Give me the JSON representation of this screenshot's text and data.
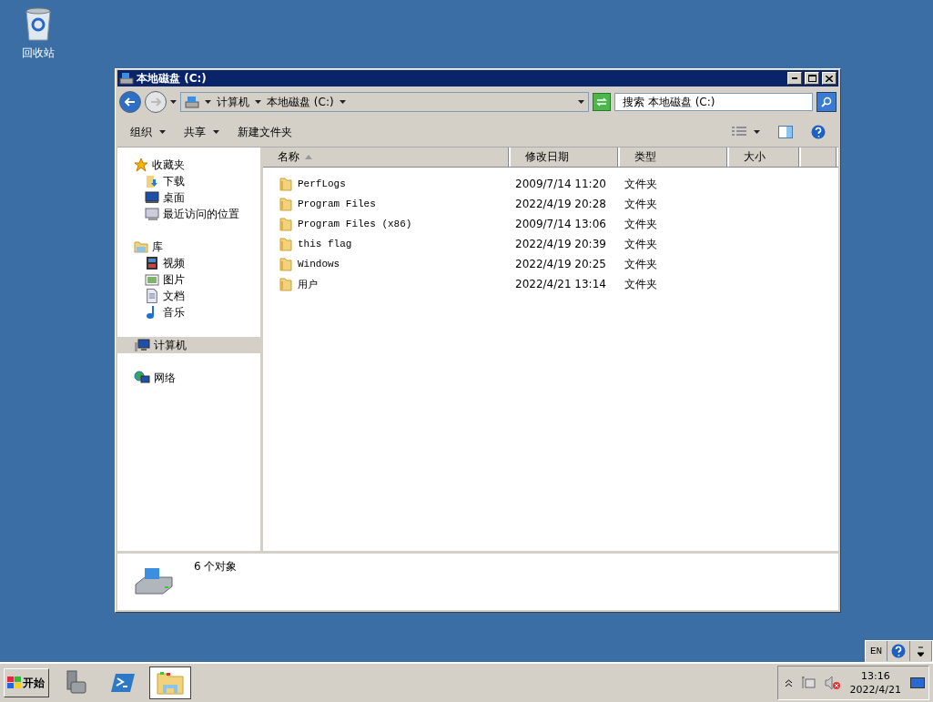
{
  "desktop_icons": [
    {
      "label": "回收站"
    }
  ],
  "window": {
    "title": "本地磁盘 (C:)",
    "address": {
      "segments": [
        "计算机",
        "本地磁盘 (C:)"
      ]
    },
    "search": {
      "placeholder": "搜索 本地磁盘 (C:)"
    },
    "toolbar": [
      {
        "label": "组织",
        "dropdown": true
      },
      {
        "label": "共享",
        "dropdown": true
      },
      {
        "label": "新建文件夹",
        "dropdown": false
      }
    ],
    "nav_groups": [
      {
        "label": "收藏夹",
        "kind": "star",
        "selected": false,
        "children": [
          {
            "label": "下载",
            "kind": "download",
            "selected": false
          },
          {
            "label": "桌面",
            "kind": "desktop",
            "selected": false
          },
          {
            "label": "最近访问的位置",
            "kind": "recent",
            "selected": false
          }
        ]
      },
      {
        "label": "库",
        "kind": "library",
        "selected": false,
        "children": [
          {
            "label": "视频",
            "kind": "video",
            "selected": false
          },
          {
            "label": "图片",
            "kind": "picture",
            "selected": false
          },
          {
            "label": "文档",
            "kind": "document",
            "selected": false
          },
          {
            "label": "音乐",
            "kind": "music",
            "selected": false
          }
        ]
      },
      {
        "label": "计算机",
        "kind": "computer",
        "selected": true
      },
      {
        "label": "网络",
        "kind": "network",
        "selected": false
      }
    ],
    "columns": [
      {
        "label": "名称",
        "sorted": true
      },
      {
        "label": "修改日期",
        "sorted": false
      },
      {
        "label": "类型",
        "sorted": false
      },
      {
        "label": "大小",
        "sorted": false
      }
    ],
    "rows": [
      {
        "name": "PerfLogs",
        "modified": "2009/7/14 11:20",
        "type": "文件夹"
      },
      {
        "name": "Program Files",
        "modified": "2022/4/19 20:28",
        "type": "文件夹"
      },
      {
        "name": "Program Files (x86)",
        "modified": "2009/7/14 13:06",
        "type": "文件夹"
      },
      {
        "name": "this flag",
        "modified": "2022/4/19 20:39",
        "type": "文件夹"
      },
      {
        "name": "Windows",
        "modified": "2022/4/19 20:25",
        "type": "文件夹"
      },
      {
        "name": "用户",
        "modified": "2022/4/21 13:14",
        "type": "文件夹"
      }
    ],
    "status": "6 个对象"
  },
  "language_bar": {
    "language": "EN"
  },
  "taskbar": {
    "start": "开始",
    "apps": [
      {
        "kind": "server",
        "selected": false
      },
      {
        "kind": "shell",
        "selected": false
      },
      {
        "kind": "explorer",
        "selected": true
      }
    ],
    "time": "13:16",
    "date": "2022/4/21"
  }
}
